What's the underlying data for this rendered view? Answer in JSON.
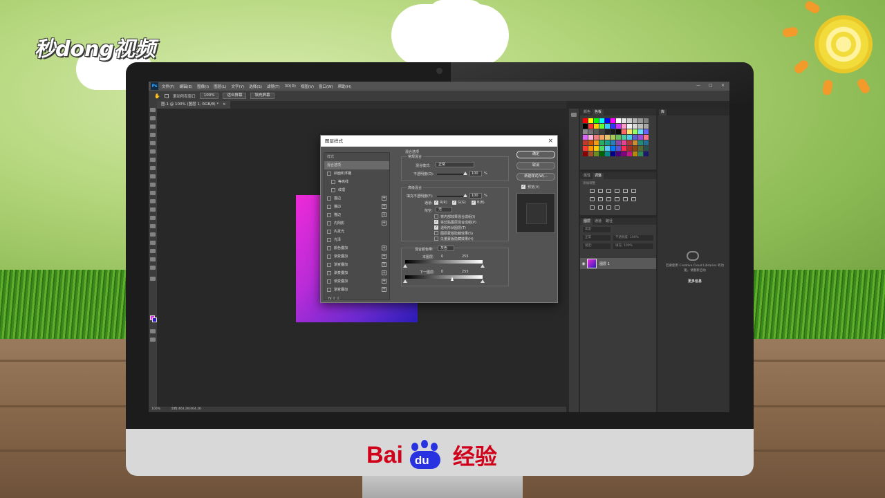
{
  "watermark": {
    "text": "秒dong视频"
  },
  "footer_brand": {
    "bai": "Bai",
    "du": "du",
    "cn": "经验"
  },
  "menubar": {
    "app_badge": "Ps",
    "items": [
      "文件(F)",
      "编辑(E)",
      "图像(I)",
      "图层(L)",
      "文字(Y)",
      "选择(S)",
      "滤镜(T)",
      "3D(D)",
      "视图(V)",
      "窗口(W)",
      "帮助(H)"
    ],
    "minimize": "—",
    "maximize": "□",
    "close": "×"
  },
  "options_bar": {
    "scroll_all_label": "滚动所有窗口",
    "zoom_value": "100%",
    "fit_screen": "适合屏幕",
    "fill_screen": "填充屏幕"
  },
  "document_tab": {
    "title": "图-1 @ 100% (图层 1, RGB/8) *",
    "close": "×"
  },
  "status_bar": {
    "zoom": "100%",
    "doc_info": "文档:464.2K/464.2K"
  },
  "colors": {
    "foreground": "#e02ee0",
    "background": "#2d1cc2",
    "gradient_start": "#ee2ad8",
    "gradient_end": "#2a1cb8"
  },
  "swatches_panel": {
    "tabs": [
      "颜色",
      "色板"
    ],
    "swatches": [
      "#ff0000",
      "#ffff00",
      "#00ff00",
      "#00ffff",
      "#0000ff",
      "#ff00ff",
      "#ffffff",
      "#e6e6e6",
      "#cccccc",
      "#b3b3b3",
      "#999999",
      "#808080",
      "#000000",
      "#ff3333",
      "#ffcc00",
      "#66ff33",
      "#33ccff",
      "#3333ff",
      "#cc33ff",
      "#ff99cc",
      "#f2f2f2",
      "#d9d9d9",
      "#bfbfbf",
      "#a6a6a6",
      "#8c8c8c",
      "#737373",
      "#595959",
      "#404040",
      "#262626",
      "#1a1a1a",
      "#0d0d0d",
      "#ff6666",
      "#ffe066",
      "#99ff66",
      "#66ddff",
      "#6666ff",
      "#dd66ff",
      "#ffb3d9",
      "#f07c7c",
      "#f4a261",
      "#e9c46a",
      "#a7c957",
      "#6bbf59",
      "#4cc9a0",
      "#48cae4",
      "#5e60ce",
      "#9d4edd",
      "#ff758f",
      "#c0392b",
      "#d35400",
      "#f39c12",
      "#27ae60",
      "#16a085",
      "#2980b9",
      "#8e44ad",
      "#e84393",
      "#b33939",
      "#cc8e35",
      "#218c74",
      "#227093",
      "#ff3b30",
      "#ff9500",
      "#ffcc00",
      "#4cd964",
      "#5ac8fa",
      "#007aff",
      "#5856d6",
      "#ff2d55",
      "#a52a2a",
      "#8b4513",
      "#556b2f",
      "#2f4f4f",
      "#8b0000",
      "#a0522d",
      "#6b8e23",
      "#006400",
      "#008b8b",
      "#00008b",
      "#4b0082",
      "#800080",
      "#c71585",
      "#b8860b",
      "#2e8b57",
      "#191970"
    ]
  },
  "adjustments_panel": {
    "tabs": [
      "属性",
      "调整"
    ],
    "hint": "添加调整"
  },
  "layers_panel": {
    "tabs": [
      "图层",
      "通道",
      "路径"
    ],
    "search_placeholder": "类型",
    "blend_mode": "正常",
    "opacity_label": "不透明度:",
    "opacity_value": "100%",
    "lock_label": "锁定:",
    "fill_label": "填充:",
    "fill_value": "100%",
    "layer_name": "图层 1",
    "eye": "◉"
  },
  "libraries_panel": {
    "tab": "库",
    "message": "若要使用 Creative Cloud Libraries 的功能，请重新启动",
    "link": "更多信息"
  },
  "layer_style_dialog": {
    "title": "图层样式",
    "close": "×",
    "list": [
      {
        "label": "样式",
        "kind": "header"
      },
      {
        "label": "混合选项",
        "kind": "active"
      },
      {
        "label": "斜面和浮雕",
        "kind": "check"
      },
      {
        "label": "等高线",
        "kind": "sub"
      },
      {
        "label": "纹理",
        "kind": "sub"
      },
      {
        "label": "描边",
        "kind": "plus"
      },
      {
        "label": "描边",
        "kind": "plus"
      },
      {
        "label": "描边",
        "kind": "plus"
      },
      {
        "label": "内阴影",
        "kind": "plus"
      },
      {
        "label": "内发光",
        "kind": "check"
      },
      {
        "label": "光泽",
        "kind": "check"
      },
      {
        "label": "颜色叠加",
        "kind": "plus"
      },
      {
        "label": "渐变叠加",
        "kind": "plus"
      },
      {
        "label": "渐变叠加",
        "kind": "plus"
      },
      {
        "label": "渐变叠加",
        "kind": "plus"
      },
      {
        "label": "渐变叠加",
        "kind": "plus"
      },
      {
        "label": "渐变叠加",
        "kind": "plus"
      }
    ],
    "footer": "fx  ⇧  ⇩",
    "blending_options_title": "混合选项",
    "general_blending_title": "常规混合",
    "blend_mode_label": "混合模式:",
    "blend_mode_value": "正常",
    "opacity_label": "不透明度(O):",
    "opacity_value": "100",
    "percent": "%",
    "advanced_blending_title": "高级混合",
    "fill_opacity_label": "填充不透明度(F):",
    "fill_opacity_value": "100",
    "channels_label": "通道:",
    "channel_r": "R(R)",
    "channel_g": "G(G)",
    "channel_b": "B(B)",
    "knockout_label": "挖空:",
    "knockout_value": "无",
    "options": [
      {
        "label": "将内部效果混合成组(I)",
        "checked": false
      },
      {
        "label": "将剪贴图层混合成组(P)",
        "checked": true
      },
      {
        "label": "透明形状图层(T)",
        "checked": true
      },
      {
        "label": "图层蒙版隐藏效果(S)",
        "checked": false
      },
      {
        "label": "矢量蒙版隐藏效果(H)",
        "checked": false
      }
    ],
    "blend_if_label": "混合颜色带:",
    "blend_if_value": "灰色",
    "this_layer_label": "本图层:",
    "this_layer_min": "0",
    "this_layer_max": "255",
    "underlying_label": "下一图层:",
    "underlying_min": "0",
    "underlying_max": "255",
    "ok": "确定",
    "cancel": "取消",
    "new_style": "新建样式(W)...",
    "preview_label": "预览(V)"
  }
}
